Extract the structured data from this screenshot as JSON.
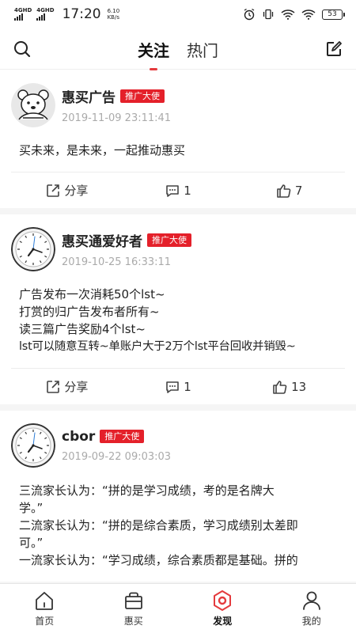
{
  "status_bar": {
    "signal1": "4GHD",
    "signal2": "4GHD",
    "time": "17:20",
    "speed_value": "6.10",
    "speed_unit": "KB/s",
    "battery": "53"
  },
  "header": {
    "tabs": [
      {
        "label": "关注",
        "active": true
      },
      {
        "label": "热门",
        "active": false
      }
    ]
  },
  "posts": [
    {
      "author": "惠买广告",
      "badge": "推广大使",
      "date": "2019-11-09 23:11:41",
      "avatar": "bear-avatar",
      "content": [
        "买未来，是未来，一起推动惠买"
      ],
      "share_label": "分享",
      "comments": "1",
      "likes": "7"
    },
    {
      "author": "惠买通爱好者",
      "badge": "推广大使",
      "date": "2019-10-25 16:33:11",
      "avatar": "clock-avatar",
      "content": [
        "广告发布一次消耗50个lst~",
        "打赏的归广告发布者所有~",
        "读三篇广告奖励4个lst~",
        "lst可以随意互转~单账户大于2万个lst平台回收并销毁~"
      ],
      "share_label": "分享",
      "comments": "1",
      "likes": "13"
    },
    {
      "author": "cbor",
      "badge": "推广大使",
      "date": "2019-09-22 09:03:03",
      "avatar": "clock-avatar",
      "content": [
        "三流家长认为：“拼的是学习成绩，考的是名牌大",
        "学。”",
        "二流家长认为：“拼的是综合素质，学习成绩别太差即",
        "可。”",
        "一流家长认为：“学习成绩，综合素质都是基础。拼的"
      ]
    }
  ],
  "bottom_nav": [
    {
      "label": "首页",
      "icon": "home-icon"
    },
    {
      "label": "惠买",
      "icon": "shop-bag-icon"
    },
    {
      "label": "发现",
      "icon": "discover-icon",
      "active": true
    },
    {
      "label": "我的",
      "icon": "profile-icon"
    }
  ],
  "colors": {
    "accent": "#e43a3d",
    "badge": "#e4202a"
  }
}
